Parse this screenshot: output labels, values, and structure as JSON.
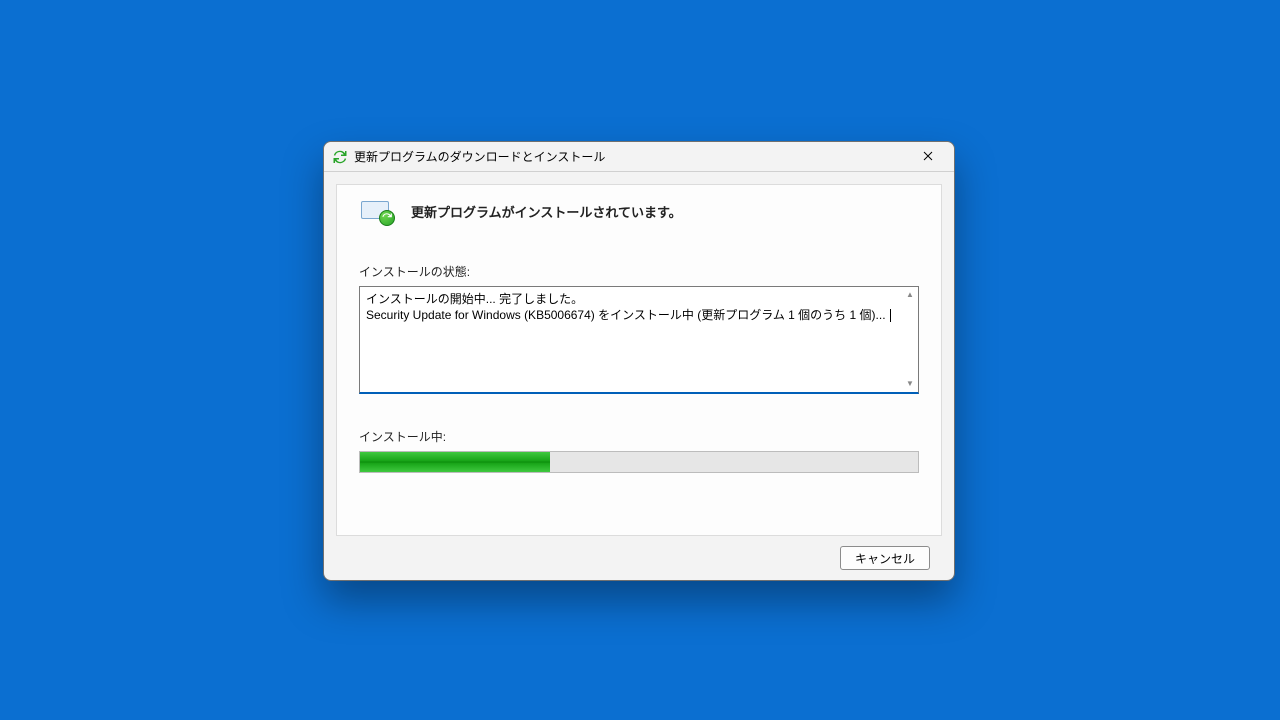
{
  "window": {
    "title": "更新プログラムのダウンロードとインストール"
  },
  "main": {
    "heading": "更新プログラムがインストールされています。",
    "status_label": "インストールの状態:",
    "status_lines": [
      "インストールの開始中... 完了しました。",
      "Security Update for Windows (KB5006674) をインストール中 (更新プログラム 1 個のうち 1 個)... "
    ],
    "progress_label": "インストール中:",
    "progress_percent": 34
  },
  "buttons": {
    "cancel": "キャンセル"
  }
}
